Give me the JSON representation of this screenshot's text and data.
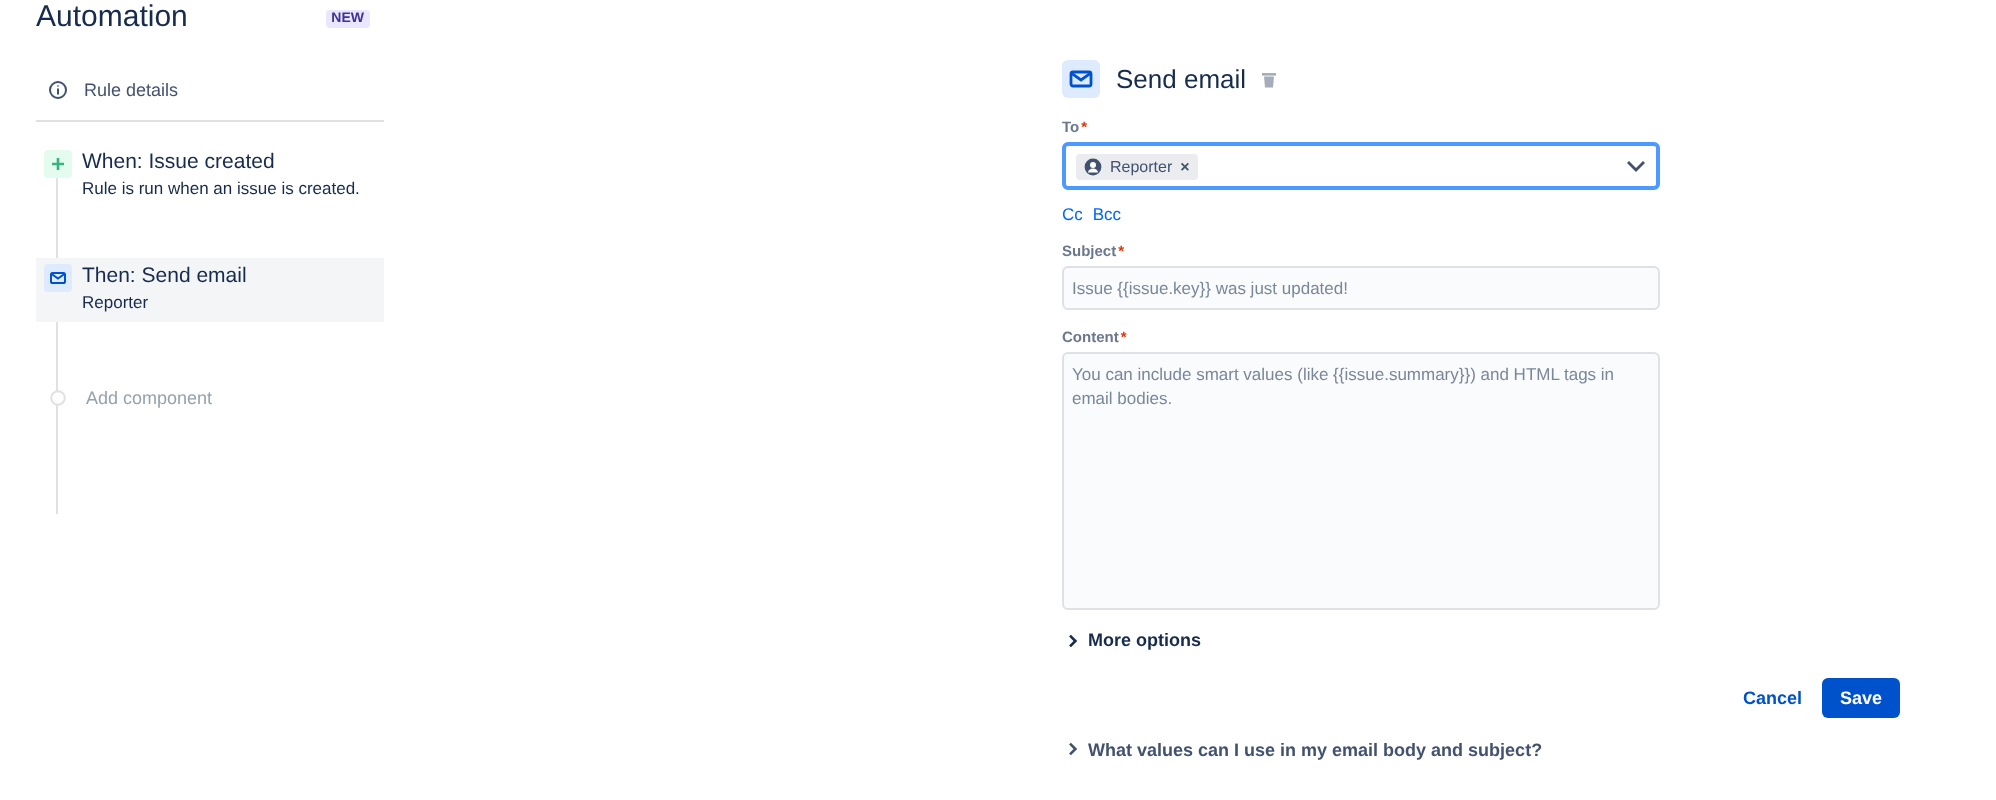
{
  "sidebar": {
    "title": "Automation",
    "badge": "NEW",
    "rule_details": "Rule details",
    "steps": [
      {
        "kind": "trigger",
        "title": "When: Issue created",
        "subtitle": "Rule is run when an issue is created.",
        "selected": false
      },
      {
        "kind": "action",
        "title": "Then: Send email",
        "subtitle": "Reporter",
        "selected": true
      }
    ],
    "add_component": "Add component"
  },
  "form": {
    "title": "Send email",
    "to": {
      "label": "To",
      "required": "*",
      "chip": "Reporter",
      "chip_remove": "×"
    },
    "cc": "Cc",
    "bcc": "Bcc",
    "subject": {
      "label": "Subject",
      "required": "*",
      "placeholder": "Issue {{issue.key}} was just updated!"
    },
    "content": {
      "label": "Content",
      "required": "*",
      "placeholder": "You can include smart values (like {{issue.summary}}) and HTML tags in email bodies."
    },
    "more_options": "More options",
    "cancel": "Cancel",
    "save": "Save",
    "help": "What values can I use in my email body and subject?"
  }
}
